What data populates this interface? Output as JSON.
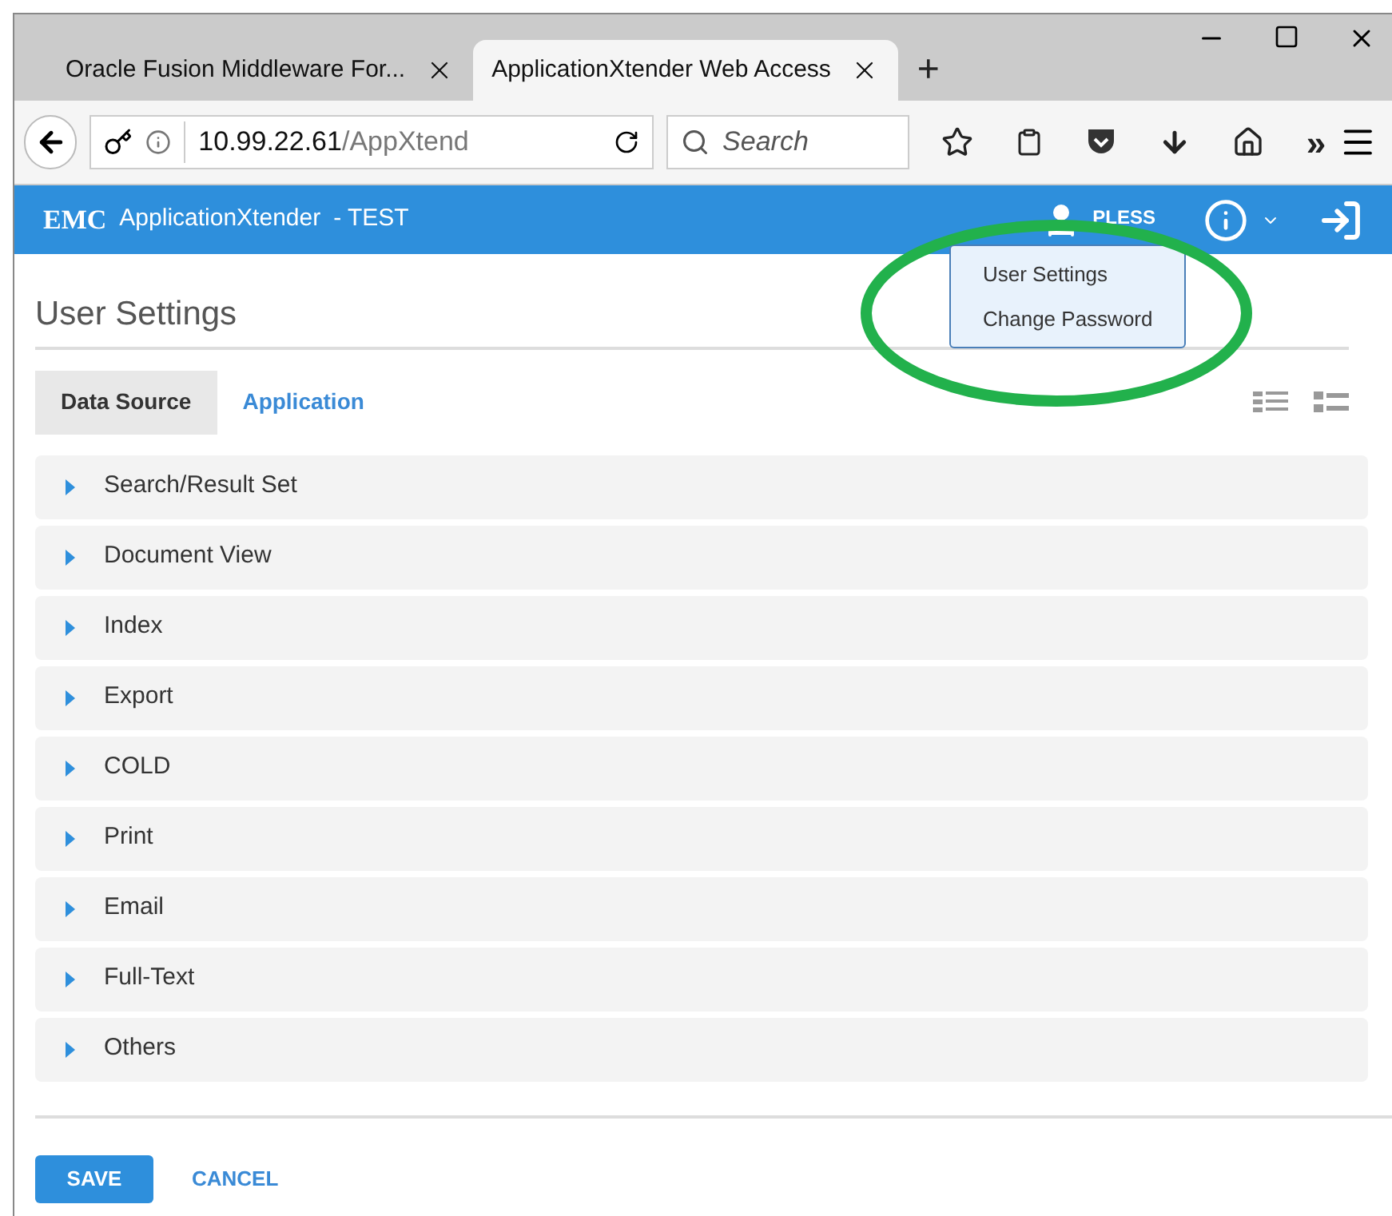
{
  "browser": {
    "tabs": [
      {
        "label": "Oracle Fusion Middleware For...",
        "selected": false
      },
      {
        "label": "ApplicationXtender Web Access",
        "selected": true
      }
    ],
    "new_tab": "+",
    "address": {
      "host": "10.99.22.61",
      "path": "/AppXtend"
    },
    "search": {
      "placeholder": "Search"
    },
    "overflow": "»"
  },
  "app_header": {
    "logo": "EMC",
    "product": "ApplicationXtender",
    "environment": "- TEST",
    "user": "PLESS"
  },
  "user_menu": {
    "items": [
      "User Settings",
      "Change Password"
    ]
  },
  "page": {
    "title": "User Settings",
    "tabs": [
      {
        "label": "Data Source",
        "selected": true
      },
      {
        "label": "Application",
        "selected": false
      }
    ],
    "sections": [
      {
        "label": "Search/Result Set",
        "expanded": false
      },
      {
        "label": "Document View",
        "expanded": false
      },
      {
        "label": "Index",
        "expanded": false
      },
      {
        "label": "Export",
        "expanded": false
      },
      {
        "label": "COLD",
        "expanded": false
      },
      {
        "label": "Print",
        "expanded": false
      },
      {
        "label": "Email",
        "expanded": false
      },
      {
        "label": "Full-Text",
        "expanded": false
      },
      {
        "label": "Others",
        "expanded": false
      }
    ],
    "buttons": [
      {
        "label": "SAVE",
        "kind": "primary"
      },
      {
        "label": "CANCEL",
        "kind": "link"
      }
    ]
  }
}
